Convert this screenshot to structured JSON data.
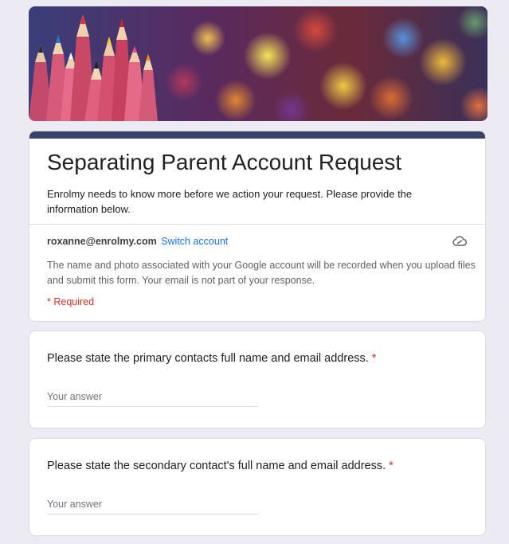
{
  "form": {
    "title": "Separating Parent Account Request",
    "description": "Enrolmy needs to know more before we action your request. Please provide the information below.",
    "account_email": "roxanne@enrolmy.com",
    "switch_account_label": "Switch account",
    "notice": "The name and photo associated with your Google account will be recorded when you upload files and submit this form. Your email is not part of your response.",
    "required_note": "* Required",
    "accent_color": "#3b4267",
    "link_color": "#1a73e8",
    "required_color": "#d93025"
  },
  "questions": [
    {
      "text": "Please state the primary contacts full name and email address.",
      "asterisk": "*",
      "placeholder": "Your answer"
    },
    {
      "text": "Please state the secondary contact's full name and email address.",
      "asterisk": "*",
      "placeholder": "Your answer"
    }
  ],
  "icons": {
    "banner": "colored-pencils-bokeh-image",
    "cloud": "cloud-offline-icon"
  }
}
